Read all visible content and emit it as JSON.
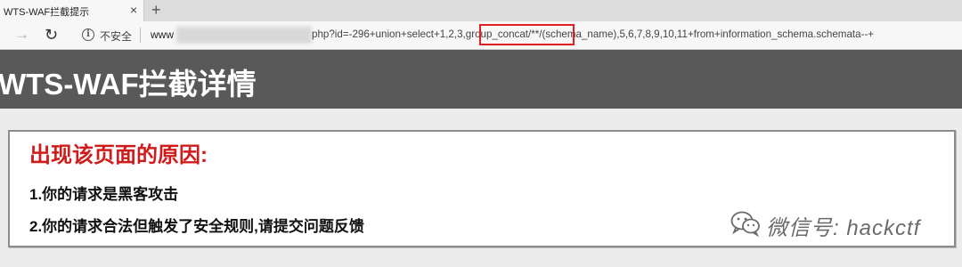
{
  "tab": {
    "title": "WTS-WAF拦截提示",
    "close": "×",
    "new_tab": "+"
  },
  "toolbar": {
    "forward": "→",
    "reload": "↻",
    "info": "i",
    "security": "不安全",
    "url_host": "www",
    "url_rest": "php?id=-296+union+select+1,2,3,group_concat/**/(schema_name),5,6,7,8,9,10,11+from+information_schema.schemata--+"
  },
  "banner": {
    "title": "WTS-WAF拦截详情"
  },
  "reasons": {
    "title": "出现该页面的原因:",
    "items": [
      "1.你的请求是黑客攻击",
      "2.你的请求合法但触发了安全规则,请提交问题反馈"
    ]
  },
  "watermark": {
    "icon": "wechat-icon",
    "text": "微信号: hackctf"
  },
  "colors": {
    "banner_bg": "#595959",
    "reason_title": "#d11a1a",
    "highlight_border": "#e02020"
  }
}
